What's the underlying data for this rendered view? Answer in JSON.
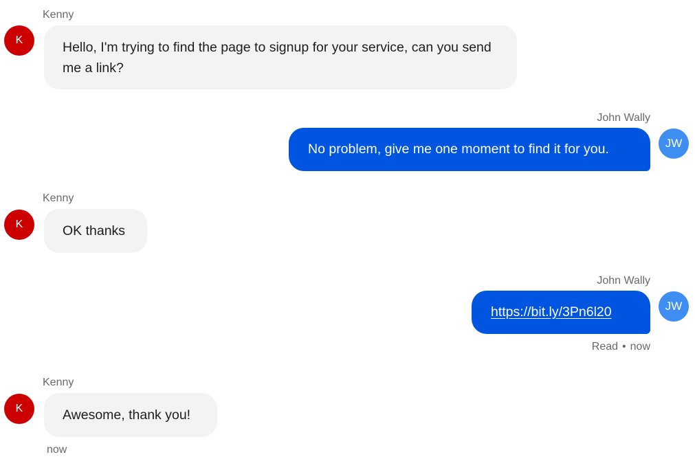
{
  "messages": [
    {
      "sender": "Kenny",
      "avatar": "K",
      "text": "Hello, I'm trying to find the page to signup for your service, can you send me a link?"
    },
    {
      "sender": "John Wally",
      "avatar": "JW",
      "text": "No problem, give me one moment to find it for you."
    },
    {
      "sender": "Kenny",
      "avatar": "K",
      "text": "OK thanks"
    },
    {
      "sender": "John Wally",
      "avatar": "JW",
      "link": "https://bit.ly/3Pn6l20",
      "status": "Read",
      "time": "now"
    },
    {
      "sender": "Kenny",
      "avatar": "K",
      "text": "Awesome, thank you!",
      "time": "now"
    }
  ],
  "colors": {
    "incoming_bubble": "#f3f3f3",
    "outgoing_bubble": "#0055e0",
    "kenny_avatar": "#cc0000",
    "john_avatar": "#3d8ef0"
  }
}
